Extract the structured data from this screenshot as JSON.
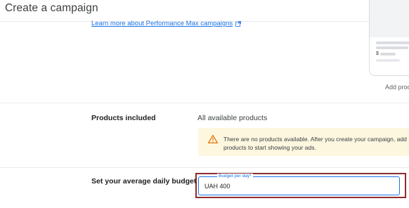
{
  "header": {
    "title": "Create a campaign"
  },
  "performance_max": {
    "learn_more_link": "Learn more about Performance Max campaigns",
    "link_icon": "open-in-new-icon"
  },
  "preview": {
    "price_symbol": "$",
    "add_products_label": "Add produ"
  },
  "products": {
    "label": "Products included",
    "value": "All available products",
    "warning": {
      "icon": "warning-icon",
      "text": "There are no products available. After you create your campaign, add products to start showing your ads."
    }
  },
  "budget": {
    "label": "Set your average daily budget",
    "field_label": "Budget per day*",
    "value": "UAH 400"
  },
  "colors": {
    "link": "#1a73e8",
    "warning_bg": "#fef7e0",
    "warning_icon": "#e37400",
    "focus": "#1a73e8",
    "highlight": "#8e2c2c"
  }
}
